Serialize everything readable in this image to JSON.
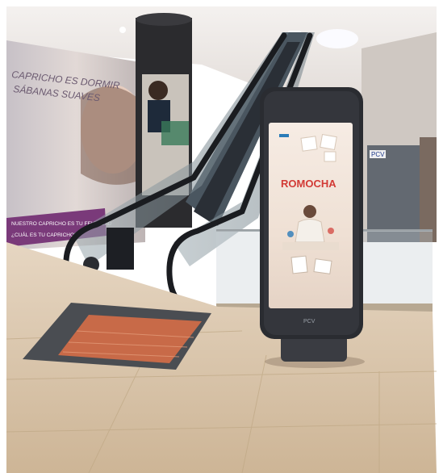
{
  "scene": {
    "banner": {
      "line1": "CAPRICHO ES DORMIR",
      "line2": "SÁBANAS SUAVES",
      "ribbon_line1": "NUESTRO CAPRICHO ES TU FELICIDAD",
      "ribbon_line2": "¿CUÁL ES TU CAPRICHO?"
    },
    "store_sign": "PCV",
    "kiosk": {
      "brand": "ROMOCHA",
      "logo_badge": "mark",
      "base_logo": "PCV"
    },
    "colors": {
      "floor": "#d9c6ad",
      "ceiling": "#efeae6",
      "kiosk_body": "#2a2c31",
      "screen_bg": "#f2e5dc",
      "ribbon": "#7a3a7a",
      "brand_red": "#d23a35",
      "brand_blue": "#2a7bb8"
    }
  }
}
